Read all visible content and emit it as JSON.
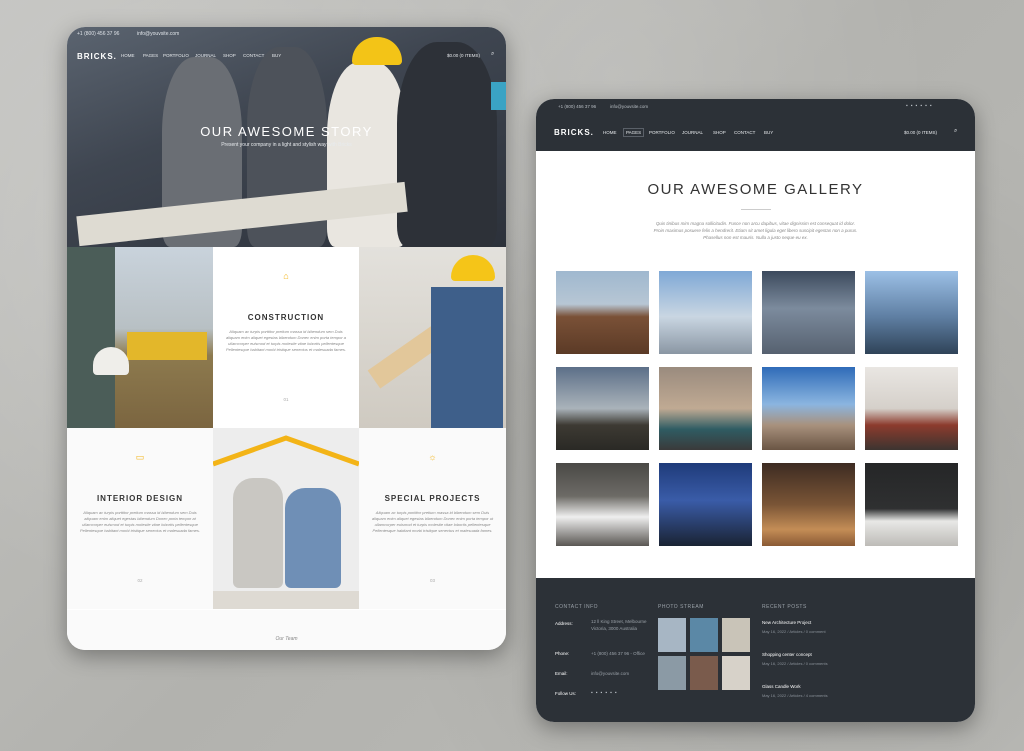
{
  "colors": {
    "accent": "#f3b417",
    "dark": "#2c3137",
    "bg": "#b9b9b6"
  },
  "left": {
    "topbar": {
      "phone": "+1 (800) 456 37 96",
      "email": "info@youvsite.com"
    },
    "logo": "BRICKS.",
    "nav": [
      "HOME",
      "PAGES",
      "PORTFOLIO",
      "JOURNAL",
      "SHOP",
      "CONTACT",
      "BUY"
    ],
    "cart": "$0.00 (0 ITEMS)",
    "hero": {
      "title": "OUR AWESOME STORY",
      "subtitle": "Present your company in a light and stylish way with Bricks"
    },
    "services": [
      {
        "title": "CONSTRUCTION",
        "icon": "home-icon",
        "num": "01",
        "text": "Aliquam ac turpis porttitor pretium massa id bibendum sem Duis aliquam enim aliquet egestas bibendum Donec enim porta tempor a ullamcorper euismod et turpis molestie vitae lobortis pellentesque Pellentesque habitant morbi tristique senectus et malesuada fames."
      },
      {
        "title": "INTERIOR DESIGN",
        "icon": "image-icon",
        "num": "02",
        "text": "Aliquam ac turpis porttitor pretium massa id bibendum sem Duis aliquam enim aliquet egestas bibendum Donec porta tempor at ullamcorper euismod et turpis molestie vitae lobortis pellentesque Pellentesque habitant morbi tristique senectus et malesuada fames."
      },
      {
        "title": "SPECIAL PROJECTS",
        "icon": "bulb-icon",
        "num": "03",
        "text": "Aliquam ac turpis porttitor pretium massa id bibendum sem Duis aliquam enim aliquet egestas bibendum Donec enim porta tempor ut ullamcorper euismod et turpis molestie vitae lobortis pellentesque Pellentesque habitant morbi tristique senectus et malesuada fames."
      }
    ],
    "team_link": "Our Team"
  },
  "right": {
    "topbar": {
      "phone": "+1 (800) 456 37 96",
      "email": "info@youvsite.com"
    },
    "logo": "BRICKS.",
    "nav": [
      "HOME",
      "PAGES",
      "PORTFOLIO",
      "JOURNAL",
      "SHOP",
      "CONTACT",
      "BUY"
    ],
    "cart": "$0.00 (0 ITEMS)",
    "gallery": {
      "title": "OUR AWESOME GALLERY",
      "desc": "Quis tinibus mim magna sollicitudin. Fusce non arcu dapibus, vitae dignissim est consequat id dolor. Proin maximus posuere felis a hendrerit. Etiam sit amet ligula eget libero suscipit egestas non a purus. Phasellus non est mauris. Nulla a justo neque eu ex."
    },
    "footer": {
      "contact_heading": "CONTACT INFO",
      "address_label": "Address:",
      "address": "12 ll King Street, Melbourne Victoria, 3000 Australia",
      "phone_label": "Phone:",
      "phone": "+1 (800) 456 37 96 - Office",
      "email_label": "Email:",
      "email": "info@youvsite.com",
      "follow_label": "Follow Us:",
      "photo_heading": "PHOTO STREAM",
      "posts_heading": "RECENT POSTS",
      "posts": [
        {
          "title": "New Architecture Project",
          "meta": "May 16, 2022 / Articles / 0 comment"
        },
        {
          "title": "Shopping center concept",
          "meta": "May 16, 2022 / Articles / 0 comments"
        },
        {
          "title": "Glass Candle Work",
          "meta": "May 16, 2022 / Articles / 4 comments"
        }
      ]
    }
  }
}
